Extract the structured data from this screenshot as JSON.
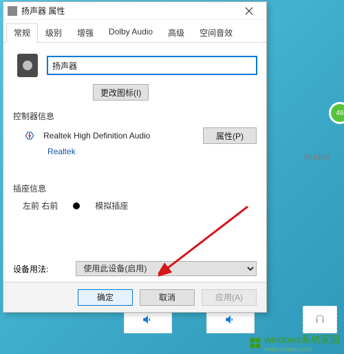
{
  "dialog": {
    "title": "扬声器 属性",
    "tabs": [
      {
        "label": "常规",
        "active": true
      },
      {
        "label": "级别",
        "active": false
      },
      {
        "label": "增强",
        "active": false
      },
      {
        "label": "Dolby Audio",
        "active": false
      },
      {
        "label": "高级",
        "active": false
      },
      {
        "label": "空间音效",
        "active": false
      }
    ],
    "device_name": "扬声器",
    "change_icon_btn": "更改图标(I)",
    "controller_section": "控制器信息",
    "controller_name": "Realtek High Definition Audio",
    "controller_vendor": "Realtek",
    "properties_btn": "属性(P)",
    "jack_section": "插座信息",
    "jack_location": "左前 右前",
    "jack_type": "模拟插座",
    "usage_label": "设备用法:",
    "usage_value": "使用此设备(启用)",
    "ok_btn": "确定",
    "cancel_btn": "取消",
    "apply_btn": "应用(A)"
  },
  "background": {
    "device_label": "Audio)",
    "badge": "46"
  },
  "watermark": "windows系统家园",
  "watermark_sub": "www.ruhaitu.com"
}
